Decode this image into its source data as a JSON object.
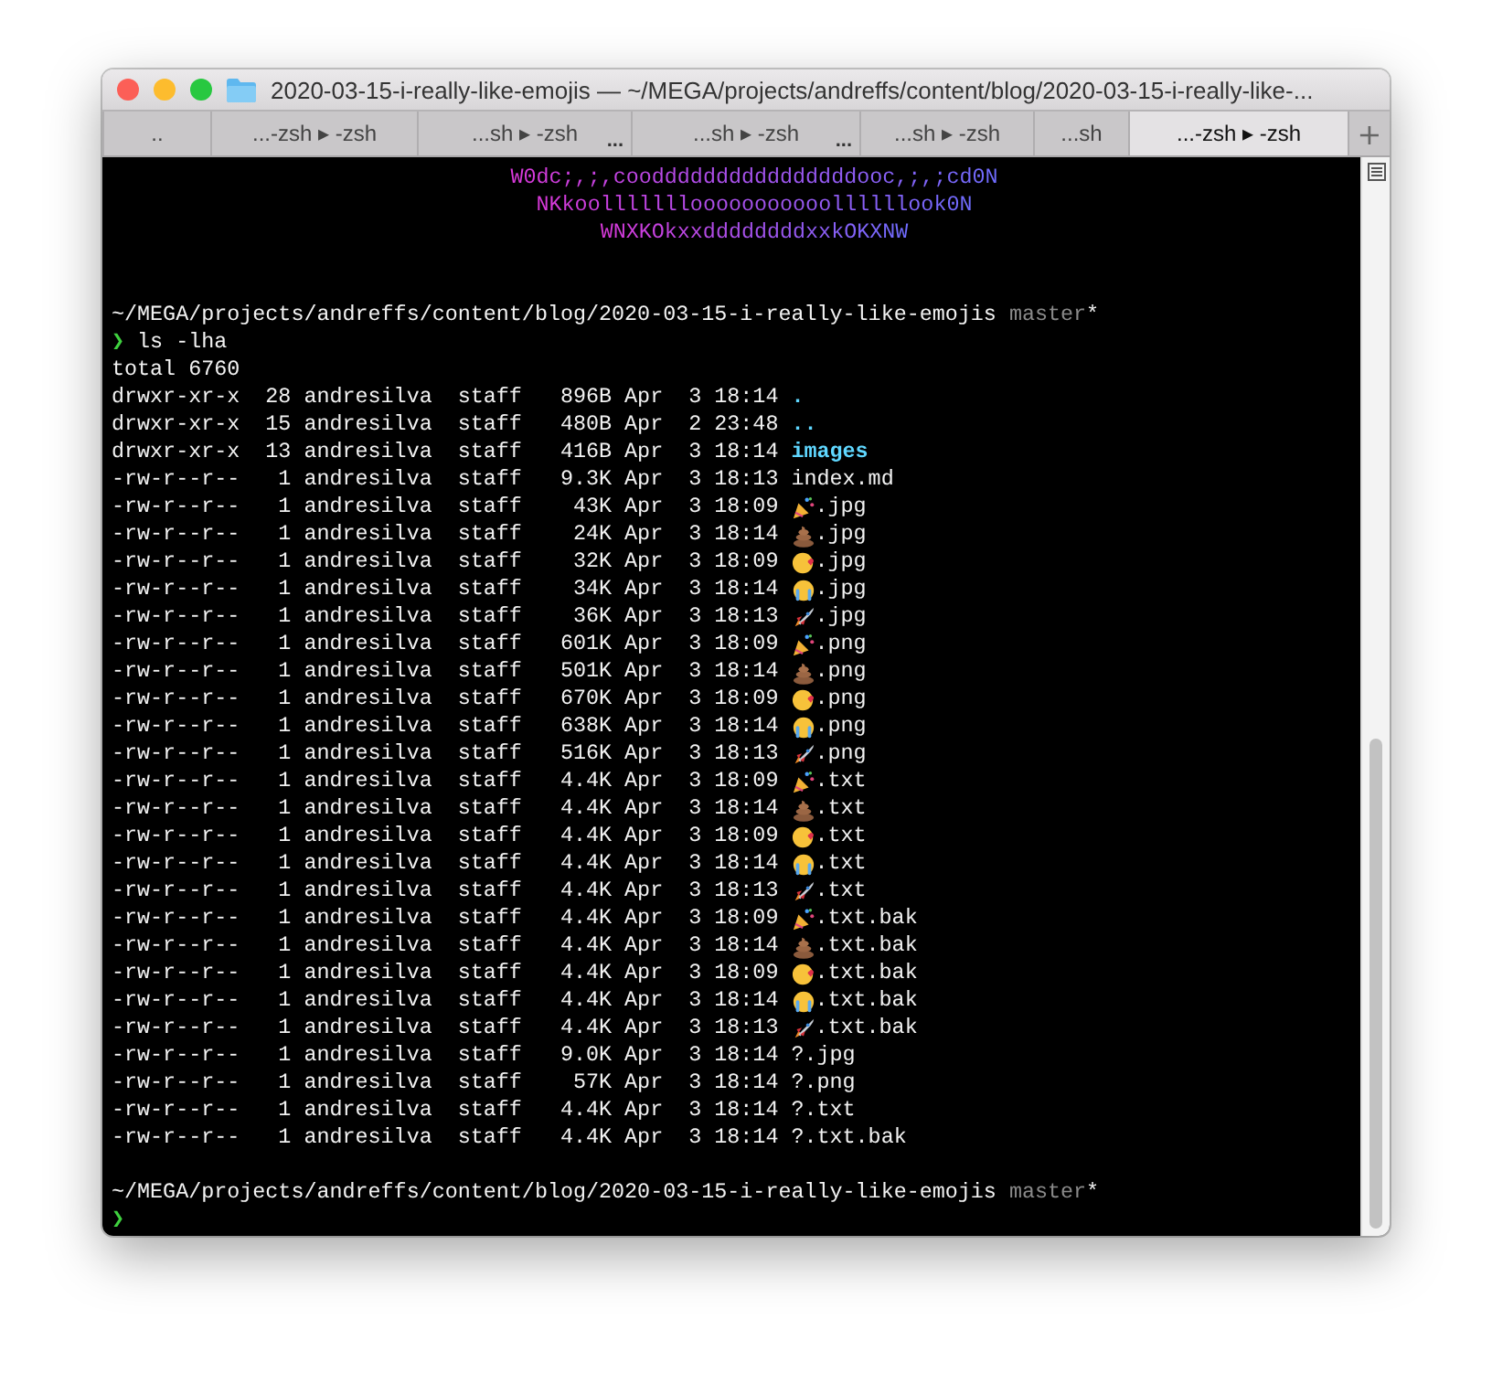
{
  "window": {
    "title": "2020-03-15-i-really-like-emojis — ~/MEGA/projects/andreffs/content/blog/2020-03-15-i-really-like-..."
  },
  "tabs": [
    {
      "label": "..",
      "selected": false
    },
    {
      "label": "...-zsh ▸ -zsh",
      "selected": false
    },
    {
      "label": "...sh ▸ -zsh",
      "more": "...",
      "selected": false
    },
    {
      "label": "...sh ▸ -zsh",
      "more": "...",
      "selected": false
    },
    {
      "label": "...sh ▸ -zsh",
      "selected": false
    },
    {
      "label": "...sh",
      "selected": false
    },
    {
      "label": "...-zsh ▸ -zsh",
      "selected": true
    }
  ],
  "new_tab": "+",
  "terminal": {
    "banner": [
      "W0dc;,;,cooddddddddddddddddooc,;,;cd0N",
      "NKkoolllllllooooooooooollllllook0N",
      "WNXKOkxxddddddddxxkOKXNW"
    ],
    "prompt": {
      "path": "~/MEGA/projects/andreffs/content/blog/2020-03-15-i-really-like-emojis",
      "branch": "master",
      "dirty": "*"
    },
    "symbol": "❯",
    "command": "ls -lha",
    "total": "total 6760",
    "entries": [
      {
        "text": "drwxr-xr-x  28 andresilva  staff   896B Apr  3 18:14",
        "name": ".",
        "kind": "directory"
      },
      {
        "text": "drwxr-xr-x  15 andresilva  staff   480B Apr  2 23:48",
        "name": "..",
        "kind": "directory"
      },
      {
        "text": "drwxr-xr-x  13 andresilva  staff   416B Apr  3 18:14",
        "name": "images",
        "kind": "directory"
      },
      {
        "text": "-rw-r--r--   1 andresilva  staff   9.3K Apr  3 18:13",
        "name": "index.md",
        "kind": "file"
      },
      {
        "text": "-rw-r--r--   1 andresilva  staff    43K Apr  3 18:09",
        "name": ".jpg",
        "kind": "party"
      },
      {
        "text": "-rw-r--r--   1 andresilva  staff    24K Apr  3 18:14",
        "name": ".jpg",
        "kind": "poop"
      },
      {
        "text": "-rw-r--r--   1 andresilva  staff    32K Apr  3 18:09",
        "name": ".jpg",
        "kind": "kiss"
      },
      {
        "text": "-rw-r--r--   1 andresilva  staff    34K Apr  3 18:14",
        "name": ".jpg",
        "kind": "cry"
      },
      {
        "text": "-rw-r--r--   1 andresilva  staff    36K Apr  3 18:13",
        "name": ".jpg",
        "kind": "rocket"
      },
      {
        "text": "-rw-r--r--   1 andresilva  staff   601K Apr  3 18:09",
        "name": ".png",
        "kind": "party"
      },
      {
        "text": "-rw-r--r--   1 andresilva  staff   501K Apr  3 18:14",
        "name": ".png",
        "kind": "poop"
      },
      {
        "text": "-rw-r--r--   1 andresilva  staff   670K Apr  3 18:09",
        "name": ".png",
        "kind": "kiss"
      },
      {
        "text": "-rw-r--r--   1 andresilva  staff   638K Apr  3 18:14",
        "name": ".png",
        "kind": "cry"
      },
      {
        "text": "-rw-r--r--   1 andresilva  staff   516K Apr  3 18:13",
        "name": ".png",
        "kind": "rocket"
      },
      {
        "text": "-rw-r--r--   1 andresilva  staff   4.4K Apr  3 18:09",
        "name": ".txt",
        "kind": "party"
      },
      {
        "text": "-rw-r--r--   1 andresilva  staff   4.4K Apr  3 18:14",
        "name": ".txt",
        "kind": "poop"
      },
      {
        "text": "-rw-r--r--   1 andresilva  staff   4.4K Apr  3 18:09",
        "name": ".txt",
        "kind": "kiss"
      },
      {
        "text": "-rw-r--r--   1 andresilva  staff   4.4K Apr  3 18:14",
        "name": ".txt",
        "kind": "cry"
      },
      {
        "text": "-rw-r--r--   1 andresilva  staff   4.4K Apr  3 18:13",
        "name": ".txt",
        "kind": "rocket"
      },
      {
        "text": "-rw-r--r--   1 andresilva  staff   4.4K Apr  3 18:09",
        "name": ".txt.bak",
        "kind": "party"
      },
      {
        "text": "-rw-r--r--   1 andresilva  staff   4.4K Apr  3 18:14",
        "name": ".txt.bak",
        "kind": "poop"
      },
      {
        "text": "-rw-r--r--   1 andresilva  staff   4.4K Apr  3 18:09",
        "name": ".txt.bak",
        "kind": "kiss"
      },
      {
        "text": "-rw-r--r--   1 andresilva  staff   4.4K Apr  3 18:14",
        "name": ".txt.bak",
        "kind": "cry"
      },
      {
        "text": "-rw-r--r--   1 andresilva  staff   4.4K Apr  3 18:13",
        "name": ".txt.bak",
        "kind": "rocket"
      },
      {
        "text": "-rw-r--r--   1 andresilva  staff   9.0K Apr  3 18:14",
        "name": "?.jpg",
        "kind": "file"
      },
      {
        "text": "-rw-r--r--   1 andresilva  staff    57K Apr  3 18:14",
        "name": "?.png",
        "kind": "file"
      },
      {
        "text": "-rw-r--r--   1 andresilva  staff   4.4K Apr  3 18:14",
        "name": "?.txt",
        "kind": "file"
      },
      {
        "text": "-rw-r--r--   1 andresilva  staff   4.4K Apr  3 18:14",
        "name": "?.txt.bak",
        "kind": "file"
      }
    ],
    "prompt_end": {
      "path": "~/MEGA/projects/andreffs/content/blog/2020-03-15-i-really-like-emojis",
      "branch": "master",
      "dirty": "*"
    },
    "symbol_end": "❯"
  }
}
